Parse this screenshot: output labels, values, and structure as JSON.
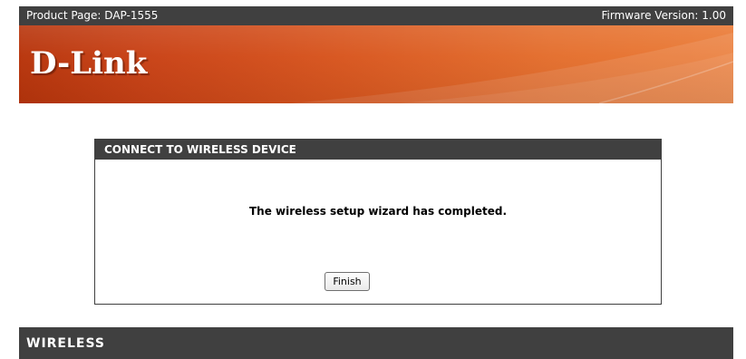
{
  "header": {
    "product_page": "Product Page: DAP-1555",
    "firmware_version": "Firmware Version: 1.00"
  },
  "brand": {
    "logo_text": "D-Link",
    "colors": {
      "banner_dark": "#b8350c",
      "banner_light": "#ea7a35",
      "bar_dark": "#404040"
    }
  },
  "panel": {
    "title": "CONNECT TO WIRELESS DEVICE",
    "message": "The wireless setup wizard has completed.",
    "finish_label": "Finish"
  },
  "footer": {
    "text": "WIRELESS"
  }
}
